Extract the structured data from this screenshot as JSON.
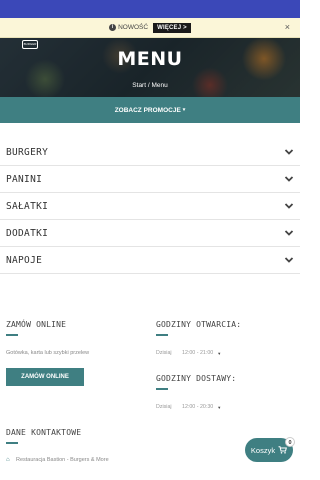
{
  "notice": {
    "label": "NOWOŚĆ",
    "more_button": "WIĘCEJ >",
    "close": "×"
  },
  "hero": {
    "logo_text": "BURGER",
    "title": "MENU",
    "breadcrumb": "Start / Menu"
  },
  "promo": {
    "label": "ZOBACZ PROMOCJE",
    "caret": "▾"
  },
  "categories": [
    {
      "label": "BURGERY"
    },
    {
      "label": "PANINI"
    },
    {
      "label": "SAŁATKI"
    },
    {
      "label": "DODATKI"
    },
    {
      "label": "NAPOJE"
    }
  ],
  "order_online": {
    "title": "ZAMÓW ONLINE",
    "payment_text": "Gotówka, karta lub szybki przelew",
    "button": "ZAMÓW ONLINE"
  },
  "opening_hours": {
    "title": "GODZINY OTWARCIA:",
    "day": "Dzisiaj",
    "time": "12:00 - 21:00"
  },
  "delivery_hours": {
    "title": "GODZINY DOSTAWY:",
    "day": "Dzisiaj",
    "time": "12:00 - 20:30"
  },
  "contact": {
    "title": "DANE KONTAKTOWE",
    "address_line": "Restauracja Bastion - Burgers & More"
  },
  "cart": {
    "label": "Koszyk",
    "count": "0"
  },
  "colors": {
    "accent": "#3f7f82",
    "top_strip": "#3b48b8",
    "notice_bg": "#fbf6d8"
  }
}
